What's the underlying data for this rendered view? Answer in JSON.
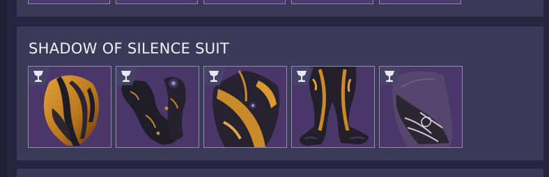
{
  "collection": {
    "set_title": "SHADOW OF SILENCE SUIT",
    "items": [
      {
        "slot": "helmet",
        "icon": "ornament-icon",
        "art": "helmet-icon"
      },
      {
        "slot": "gauntlets",
        "icon": "ornament-icon",
        "art": "gauntlets-icon"
      },
      {
        "slot": "chest",
        "icon": "ornament-icon",
        "art": "chest-armor-icon"
      },
      {
        "slot": "legs",
        "icon": "ornament-icon",
        "art": "leg-armor-icon"
      },
      {
        "slot": "class-item",
        "icon": "ornament-icon",
        "art": "cloak-icon"
      }
    ]
  },
  "colors": {
    "background": "#262640",
    "panel": "#3b3b59",
    "tile": "#4a3668",
    "tile_border": "#8f8fa8",
    "text": "#f1f0f7",
    "armor_gold": "#c98a2a",
    "armor_dark": "#1c1a22"
  }
}
